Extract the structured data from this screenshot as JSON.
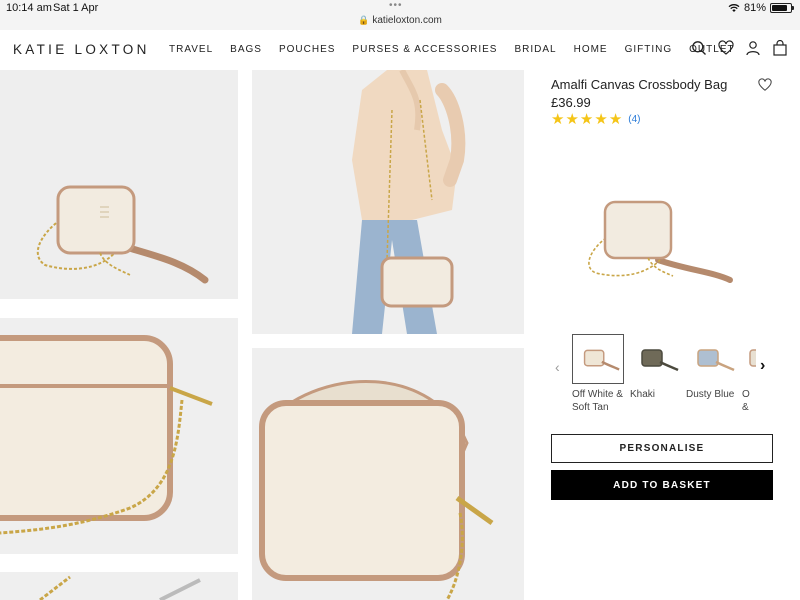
{
  "status_bar": {
    "time": "10:14 am",
    "date": "Sat 1 Apr",
    "url": "katieloxton.com",
    "battery": "81%",
    "battery_level": 0.81
  },
  "nav": {
    "logo": "KATIE LOXTON",
    "links": [
      "TRAVEL",
      "BAGS",
      "POUCHES",
      "PURSES & ACCESSORIES",
      "BRIDAL",
      "HOME",
      "GIFTING",
      "OUTLET"
    ],
    "icons": [
      "search-icon",
      "heart-icon",
      "account-icon",
      "basket-icon"
    ]
  },
  "product": {
    "title": "Amalfi Canvas Crossbody Bag",
    "price": "£36.99",
    "rating": 5,
    "review_count": "(4)",
    "colors": [
      {
        "label": "Off White & Soft Tan",
        "selected": true,
        "swatch": "#efe6d6",
        "trim": "#c49a7e"
      },
      {
        "label": "Khaki",
        "selected": false,
        "swatch": "#6f6a58",
        "trim": "#4c4a3e"
      },
      {
        "label": "Dusty Blue",
        "selected": false,
        "swatch": "#aebfd1",
        "trim": "#c9a37f"
      },
      {
        "label": "O &",
        "selected": false,
        "swatch": "#e8e0d2",
        "trim": "#c49a7e"
      }
    ]
  },
  "buttons": {
    "personalise": "PERSONALISE",
    "add_to_basket": "ADD TO BASKET"
  },
  "colors": {
    "star": "#f5c518",
    "review_link": "#2a7bd8",
    "bag_canvas": "#f1e9dc",
    "bag_trim": "#c49a7e",
    "chain": "#c9a648"
  }
}
